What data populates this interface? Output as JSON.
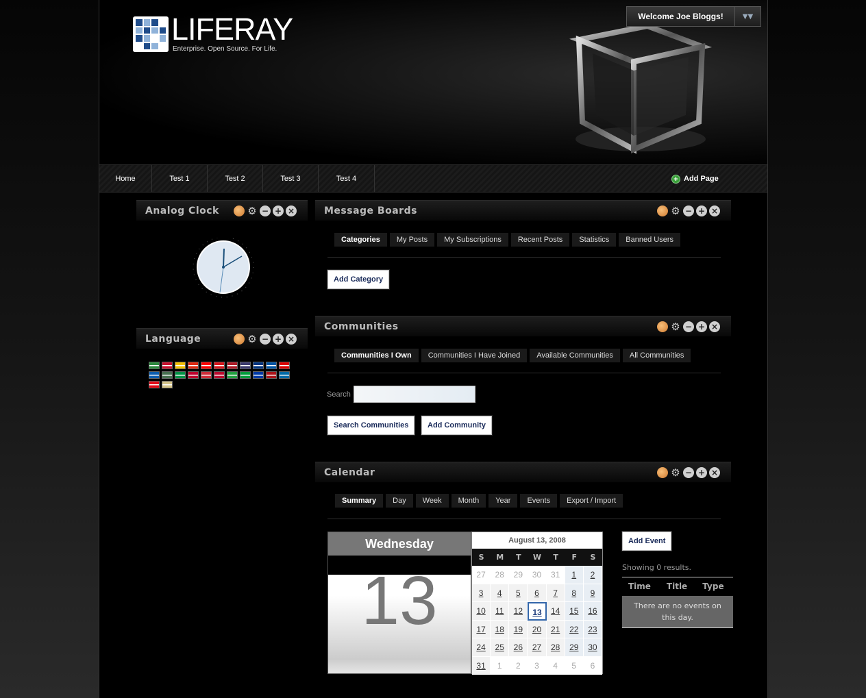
{
  "header": {
    "logo_text": "LIFERAY",
    "tagline": "Enterprise. Open Source. For Life.",
    "welcome": "Welcome Joe Bloggs!",
    "welcome_menu_icon": "chevron-down-icon"
  },
  "nav": {
    "items": [
      {
        "label": "Home"
      },
      {
        "label": "Test 1"
      },
      {
        "label": "Test 2"
      },
      {
        "label": "Test 3"
      },
      {
        "label": "Test 4"
      }
    ],
    "add_page": "Add Page"
  },
  "portlet_icons": [
    "look-and-feel-icon",
    "configuration-icon",
    "minimize-icon",
    "maximize-icon",
    "close-icon"
  ],
  "analog_clock": {
    "title": "Analog Clock"
  },
  "language": {
    "title": "Language",
    "flag_colors": [
      "#2d8a3e",
      "#c8102e",
      "#f1bf00",
      "#de2910",
      "#fe0000",
      "#d7141a",
      "#ae1c28",
      "#3c3b6e",
      "#003580",
      "#0055a4",
      "#dd0000",
      "#0d5eaf",
      "#477050",
      "#009246",
      "#bc002d",
      "#cd2e3a",
      "#ba0c2f",
      "#239f40",
      "#009c3b",
      "#0039a6",
      "#aa151b",
      "#006aa7",
      "#e30a17",
      "#d4c48a"
    ]
  },
  "message_boards": {
    "title": "Message Boards",
    "tabs": [
      "Categories",
      "My Posts",
      "My Subscriptions",
      "Recent Posts",
      "Statistics",
      "Banned Users"
    ],
    "add_category": "Add Category"
  },
  "communities": {
    "title": "Communities",
    "tabs": [
      "Communities I Own",
      "Communities I Have Joined",
      "Available Communities",
      "All Communities"
    ],
    "search_label": "Search",
    "search_value": "",
    "search_button": "Search Communities",
    "add_button": "Add Community"
  },
  "calendar": {
    "title": "Calendar",
    "tabs": [
      "Summary",
      "Day",
      "Week",
      "Month",
      "Year",
      "Events",
      "Export / Import"
    ],
    "weekday": "Wednesday",
    "day_number": "13",
    "month_label": "August 13, 2008",
    "day_headers": [
      "S",
      "M",
      "T",
      "W",
      "T",
      "F",
      "S"
    ],
    "days": [
      [
        "27",
        "28",
        "29",
        "30",
        "31",
        "1",
        "2"
      ],
      [
        "3",
        "4",
        "5",
        "6",
        "7",
        "8",
        "9"
      ],
      [
        "10",
        "11",
        "12",
        "13",
        "14",
        "15",
        "16"
      ],
      [
        "17",
        "18",
        "19",
        "20",
        "21",
        "22",
        "23"
      ],
      [
        "24",
        "25",
        "26",
        "27",
        "28",
        "29",
        "30"
      ],
      [
        "31",
        "1",
        "2",
        "3",
        "4",
        "5",
        "6"
      ]
    ],
    "add_event": "Add Event",
    "results": "Showing 0 results.",
    "columns": [
      "Time",
      "Title",
      "Type"
    ],
    "empty": "There are no events on this day."
  }
}
